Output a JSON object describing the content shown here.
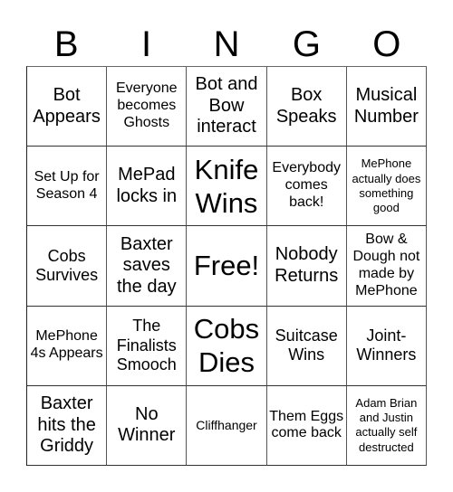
{
  "header": {
    "letters": [
      "B",
      "I",
      "N",
      "G",
      "O"
    ]
  },
  "card": {
    "rows": [
      [
        {
          "text": "Bot Appears",
          "size": "l"
        },
        {
          "text": "Everyone becomes Ghosts",
          "size": "s"
        },
        {
          "text": "Bot and Bow interact",
          "size": "l"
        },
        {
          "text": "Box Speaks",
          "size": "l"
        },
        {
          "text": "Musical Number",
          "size": "l"
        }
      ],
      [
        {
          "text": "Set Up for Season 4",
          "size": "s"
        },
        {
          "text": "MePad locks in",
          "size": "l"
        },
        {
          "text": "Knife Wins",
          "size": "xl"
        },
        {
          "text": "Everybody comes back!",
          "size": "s"
        },
        {
          "text": "MePhone actually does something good",
          "size": "xs"
        }
      ],
      [
        {
          "text": "Cobs Survives",
          "size": "m"
        },
        {
          "text": "Baxter saves the day",
          "size": "l"
        },
        {
          "text": "Free!",
          "size": "xl"
        },
        {
          "text": "Nobody Returns",
          "size": "l"
        },
        {
          "text": "Bow & Dough not made by MePhone",
          "size": "s"
        }
      ],
      [
        {
          "text": "MePhone 4s Appears",
          "size": "s"
        },
        {
          "text": "The Finalists Smooch",
          "size": "m"
        },
        {
          "text": "Cobs Dies",
          "size": "xl"
        },
        {
          "text": "Suitcase Wins",
          "size": "m"
        },
        {
          "text": "Joint-Winners",
          "size": "m"
        }
      ],
      [
        {
          "text": "Baxter hits the Griddy",
          "size": "l"
        },
        {
          "text": "No Winner",
          "size": "l"
        },
        {
          "text": "Cliffhanger",
          "size": "xxs"
        },
        {
          "text": "Them Eggs come back",
          "size": "s"
        },
        {
          "text": "Adam Brian and Justin actually self destructed",
          "size": "xs"
        }
      ]
    ]
  }
}
